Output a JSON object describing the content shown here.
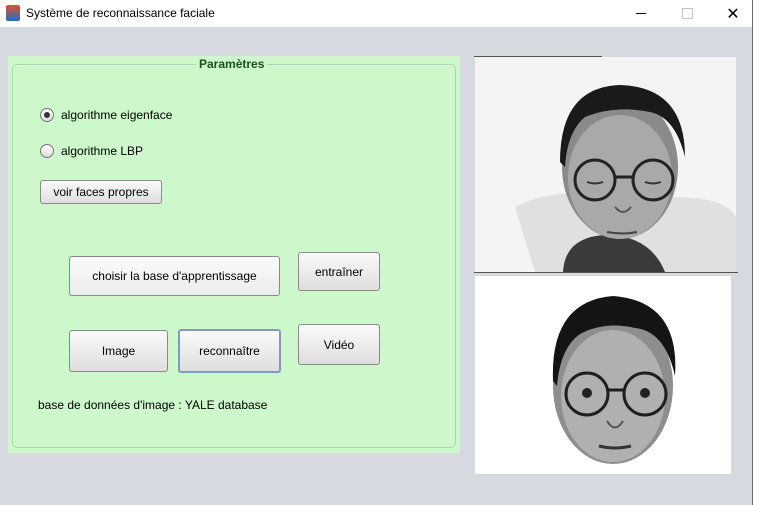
{
  "window": {
    "title": "Système de reconnaissance faciale",
    "min_icon": "minimize-icon",
    "max_icon": "maximize-icon",
    "close_icon": "close-icon",
    "close_glyph": "✕"
  },
  "panel": {
    "title": "Paramètres",
    "radios": [
      {
        "label": "algorithme eigenface",
        "checked": true
      },
      {
        "label": "algorithme LBP",
        "checked": false
      }
    ],
    "buttons": {
      "eigenfaces": "voir faces propres",
      "choose_base": "choisir la base d'apprentissage",
      "train": "entraîner",
      "image": "Image",
      "recognize": "reconnaître",
      "video": "Vidéo"
    },
    "info": "base de données  d'image : YALE database"
  },
  "colors": {
    "panel_bg": "#ccf8cc",
    "window_bg": "#d6d9df"
  }
}
